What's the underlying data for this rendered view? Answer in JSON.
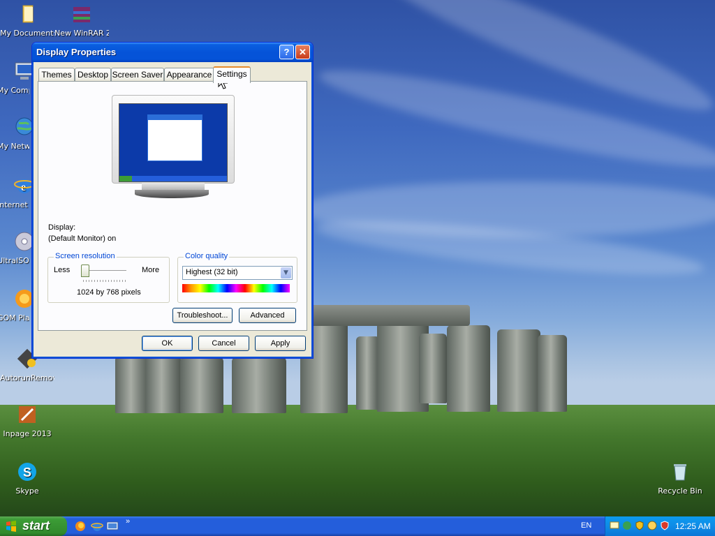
{
  "desktop": {
    "icons": [
      {
        "label": "My Documents"
      },
      {
        "label": "New WinRAR ZIP archive"
      },
      {
        "label": "My Computer"
      },
      {
        "label": "My Network Places"
      },
      {
        "label": "Internet Explorer"
      },
      {
        "label": "UltraISO"
      },
      {
        "label": "GOM Player"
      },
      {
        "label": "AutorunRemover"
      },
      {
        "label": "Inpage 2013"
      },
      {
        "label": "Skype"
      },
      {
        "label": "Recycle Bin"
      }
    ]
  },
  "dialog": {
    "title": "Display Properties",
    "help_label": "?",
    "close_label": "✕",
    "tabs": [
      {
        "label": "Themes"
      },
      {
        "label": "Desktop"
      },
      {
        "label": "Screen Saver"
      },
      {
        "label": "Appearance"
      },
      {
        "label": "Settings",
        "active": true
      }
    ],
    "display_label": "Display:",
    "display_value": "(Default Monitor) on",
    "resolution": {
      "group_title": "Screen resolution",
      "less": "Less",
      "more": "More",
      "value_text": "1024 by 768 pixels",
      "slider_position": 0
    },
    "color_quality": {
      "group_title": "Color quality",
      "selected": "Highest (32 bit)"
    },
    "buttons": {
      "troubleshoot": "Troubleshoot...",
      "advanced": "Advanced",
      "ok": "OK",
      "cancel": "Cancel",
      "apply": "Apply"
    }
  },
  "taskbar": {
    "start_label": "start",
    "language": "EN",
    "time": "12:25 AM",
    "quicklaunch_expand": "»"
  },
  "colors": {
    "titlebar": "#0553d8",
    "taskbar": "#245edb",
    "start": "#3c9c36",
    "tray": "#0f8be6",
    "group_title": "#0046d5",
    "active_tab": "#e68b2c"
  }
}
